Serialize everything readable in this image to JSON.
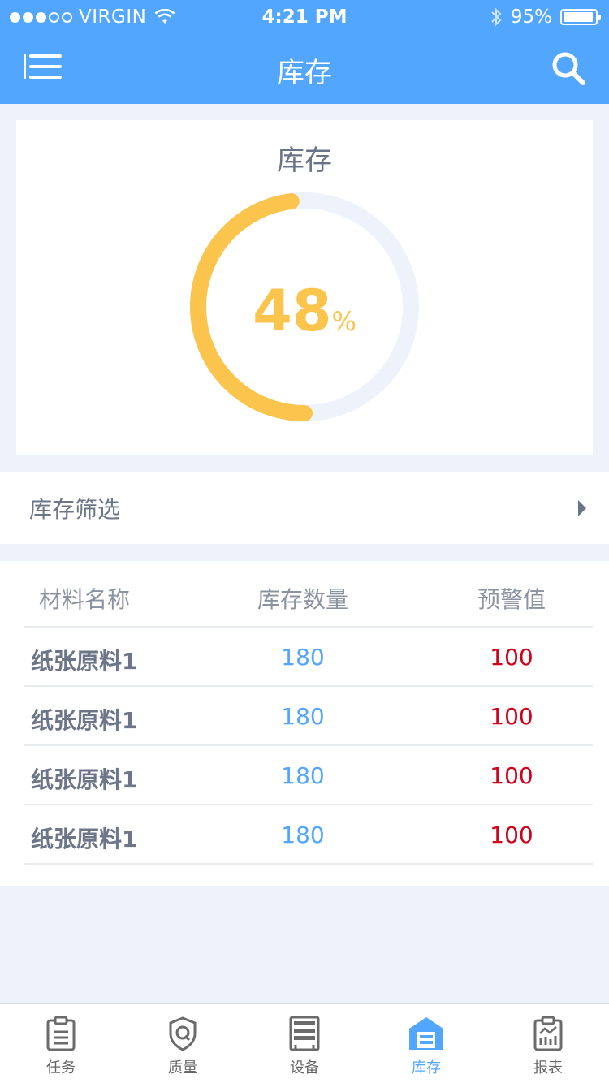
{
  "status_bar": {
    "carrier": "VIRGIN",
    "time": "4:21 PM",
    "battery": "95%"
  },
  "nav": {
    "title": "库存",
    "menu_icon": "menu-icon",
    "search_icon": "search-icon"
  },
  "gauge": {
    "title": "库存",
    "value": "48",
    "unit": "%",
    "progress_fraction": 0.48,
    "color_fill": "#fbc44c",
    "color_track": "#eef3fb"
  },
  "filter": {
    "label": "库存筛选"
  },
  "table": {
    "headers": [
      "材料名称",
      "库存数量",
      "预警值"
    ],
    "rows": [
      {
        "name": "纸张原料1",
        "qty": "180",
        "warn": "100"
      },
      {
        "name": "纸张原料1",
        "qty": "180",
        "warn": "100"
      },
      {
        "name": "纸张原料1",
        "qty": "180",
        "warn": "100"
      },
      {
        "name": "纸张原料1",
        "qty": "180",
        "warn": "100"
      }
    ]
  },
  "tabs": [
    {
      "label": "任务",
      "icon": "clipboard-icon"
    },
    {
      "label": "质量",
      "icon": "shield-icon"
    },
    {
      "label": "设备",
      "icon": "server-rack-icon"
    },
    {
      "label": "库存",
      "icon": "warehouse-icon",
      "active": true
    },
    {
      "label": "报表",
      "icon": "report-icon"
    }
  ],
  "colors": {
    "accent": "#53a6fd",
    "warning": "#d0021b",
    "gauge": "#fbc44c"
  }
}
